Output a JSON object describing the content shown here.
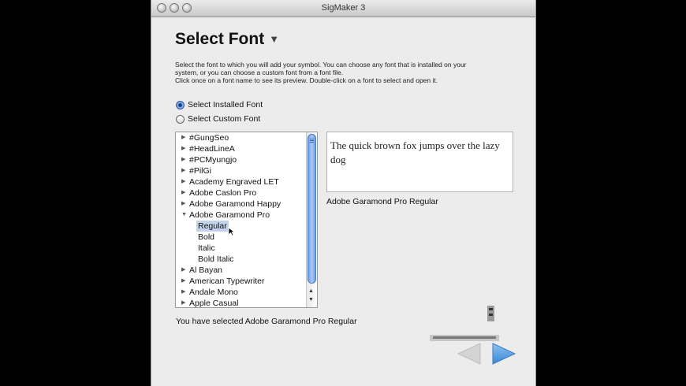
{
  "window": {
    "title": "SigMaker 3"
  },
  "header": {
    "title": "Select Font",
    "dropdown_icon": "triangle-down-icon"
  },
  "instructions": {
    "line1": "Select the font to which you will add your symbol. You can choose any font that is installed on your",
    "line2": "system, or you can choose a custom font from a font file.",
    "line3": "Click once on a font name to see its preview. Double-click on a font to select and open it."
  },
  "source_options": [
    {
      "label": "Select Installed Font",
      "selected": true
    },
    {
      "label": "Select Custom Font",
      "selected": false
    }
  ],
  "font_list": [
    {
      "label": "#GungSeo",
      "type": "family"
    },
    {
      "label": "#HeadLineA",
      "type": "family"
    },
    {
      "label": "#PCMyungjo",
      "type": "family"
    },
    {
      "label": "#PilGi",
      "type": "family"
    },
    {
      "label": "Academy Engraved LET",
      "type": "family"
    },
    {
      "label": "Adobe Caslon Pro",
      "type": "family"
    },
    {
      "label": "Adobe Garamond Happy",
      "type": "family"
    },
    {
      "label": "Adobe Garamond Pro",
      "type": "family-open"
    },
    {
      "label": "Regular",
      "type": "style",
      "selected": true
    },
    {
      "label": "Bold",
      "type": "style"
    },
    {
      "label": "Italic",
      "type": "style"
    },
    {
      "label": "Bold Italic",
      "type": "style"
    },
    {
      "label": "Al Bayan",
      "type": "family"
    },
    {
      "label": "American Typewriter",
      "type": "family"
    },
    {
      "label": "Andale Mono",
      "type": "family"
    },
    {
      "label": "Apple Casual",
      "type": "family"
    }
  ],
  "preview": {
    "sample_text": "The quick brown fox jumps over the lazy dog",
    "font_name": "Adobe Garamond Pro Regular"
  },
  "status": {
    "selected_text": "You have selected Adobe Garamond Pro Regular"
  },
  "navigation": {
    "back_icon": "arrow-left-icon",
    "next_icon": "arrow-right-icon"
  },
  "colors": {
    "selection": "#c3d3ea",
    "accent": "#5a9ee0"
  }
}
